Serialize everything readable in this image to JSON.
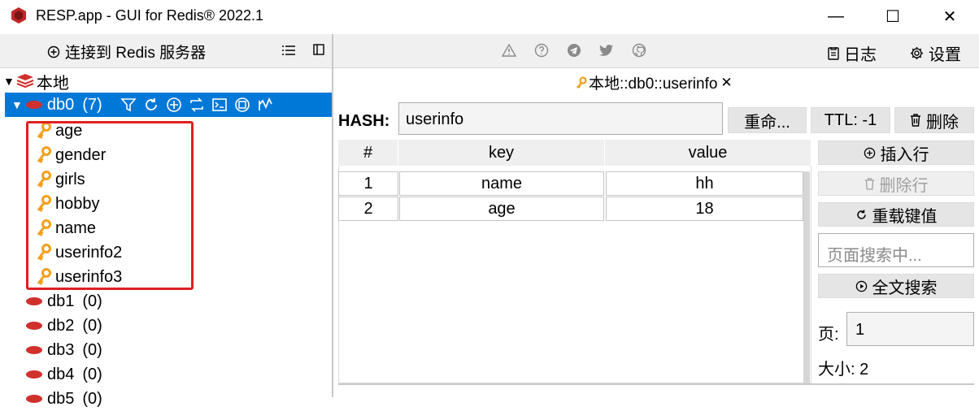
{
  "window": {
    "title": "RESP.app - GUI for Redis® 2022.1",
    "minimize_glyph": "—",
    "maximize_glyph": "☐",
    "close_glyph": "✕"
  },
  "left_toolbar": {
    "connect_label": "连接到 Redis 服务器",
    "connect_icon": "plus-circle-icon",
    "list_icon": "list-icon",
    "layout_icon": "split-view-icon"
  },
  "right_toolbar": {
    "icons": [
      "warning-icon",
      "help-icon",
      "telegram-icon",
      "twitter-icon",
      "github-icon"
    ],
    "log_label": "日志",
    "settings_label": "设置"
  },
  "tree": {
    "connection": "本地",
    "db0": {
      "name": "db0",
      "count": "(7)"
    },
    "keys": [
      "age",
      "gender",
      "girls",
      "hobby",
      "name",
      "userinfo2",
      "userinfo3"
    ],
    "dbs": [
      {
        "name": "db1",
        "count": "(0)"
      },
      {
        "name": "db2",
        "count": "(0)"
      },
      {
        "name": "db3",
        "count": "(0)"
      },
      {
        "name": "db4",
        "count": "(0)"
      },
      {
        "name": "db5",
        "count": "(0)"
      }
    ]
  },
  "tab": {
    "label": "本地::db0::userinfo",
    "close": "✕"
  },
  "key_view": {
    "type_label": "HASH:",
    "key_name": "userinfo",
    "rename_label": "重命...",
    "ttl_label": "TTL: -1",
    "delete_label": "删除"
  },
  "table": {
    "headers": [
      "#",
      "key",
      "value"
    ],
    "rows": [
      {
        "index": "1",
        "key": "name",
        "value": "hh"
      },
      {
        "index": "2",
        "key": "age",
        "value": "18"
      }
    ]
  },
  "side": {
    "insert_row": "插入行",
    "delete_row": "删除行",
    "reload": "重载键值",
    "search_placeholder": "页面搜索中...",
    "fulltext_search": "全文搜索",
    "page_label": "页:",
    "page_value": "1",
    "size_text": "大小: 2"
  },
  "colors": {
    "selection": "#0078d7",
    "redis_red": "#d0312d",
    "key_orange": "#f0a020",
    "highlight_box": "#e02020"
  }
}
